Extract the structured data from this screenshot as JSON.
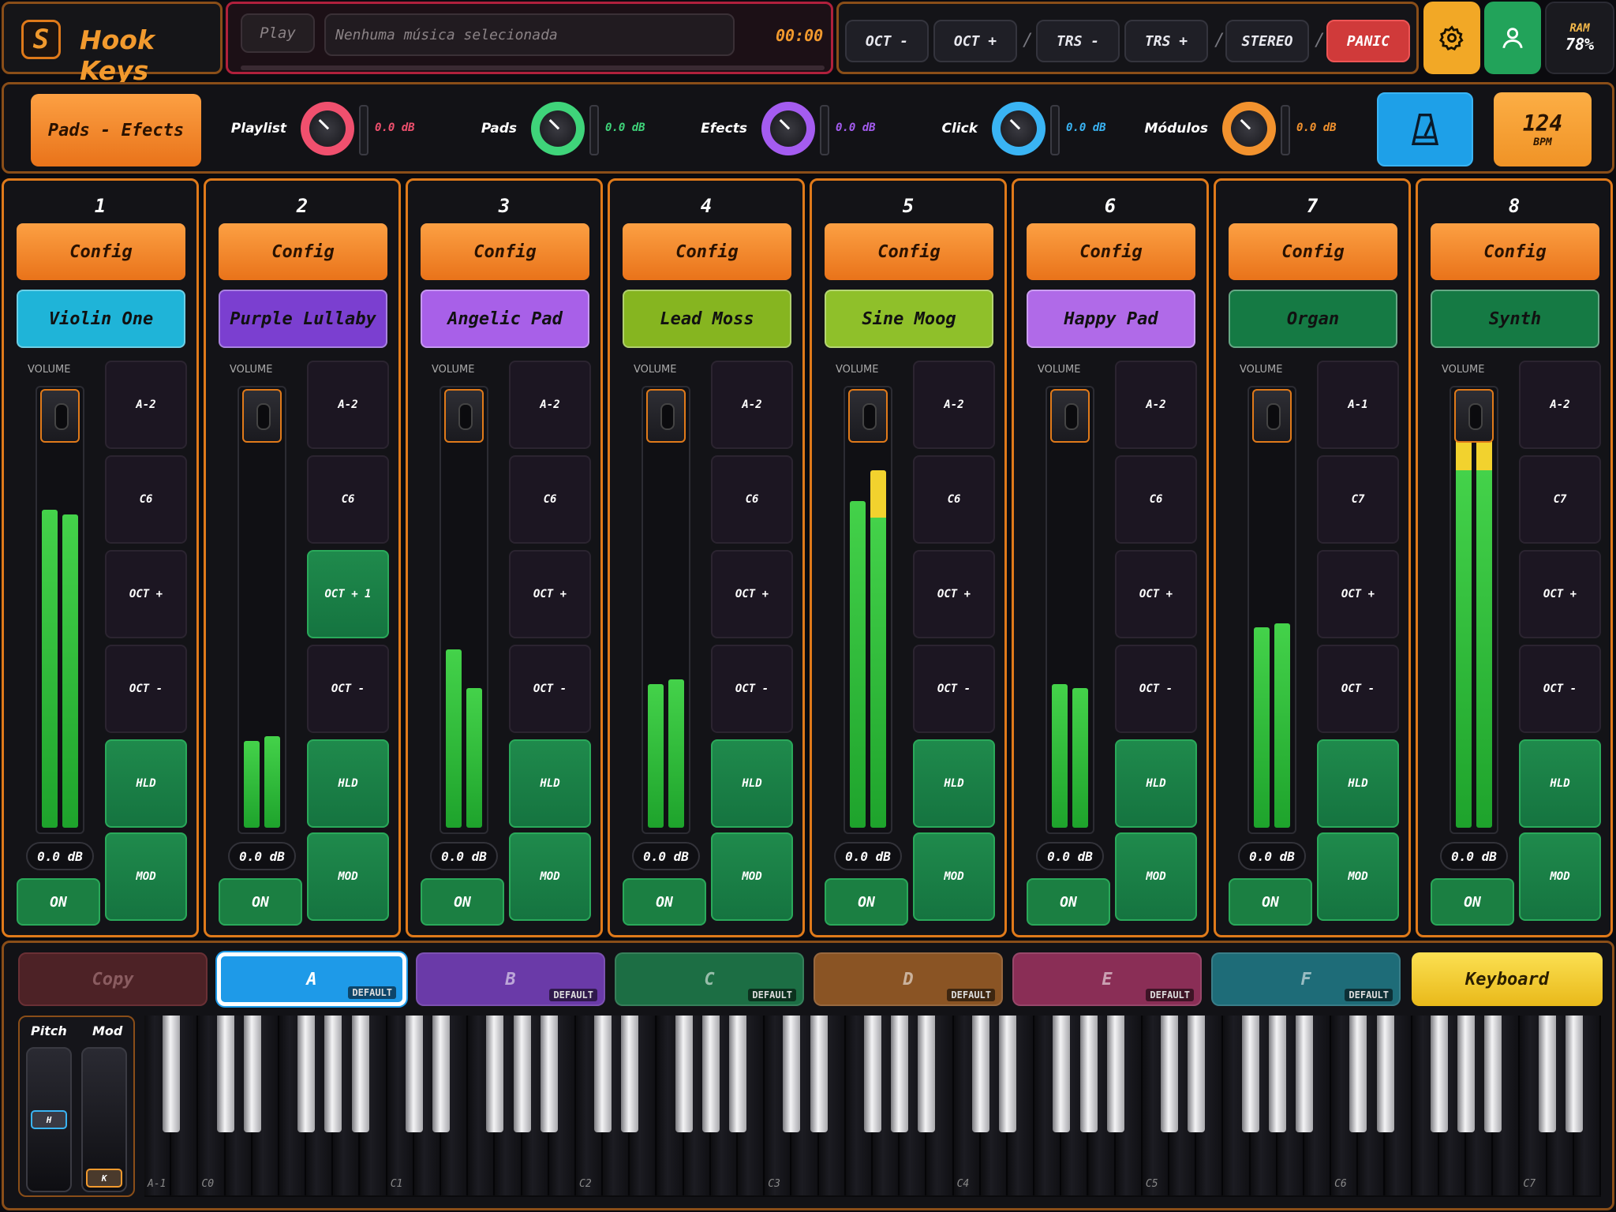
{
  "app": {
    "name": "Hook Keys",
    "logo_letter": "S"
  },
  "player": {
    "play_label": "Play",
    "track_placeholder": "Nenhuma música selecionada",
    "time": "00:00"
  },
  "transport": {
    "oct_minus": "OCT -",
    "oct_plus": "OCT +",
    "trs_minus": "TRS -",
    "trs_plus": "TRS +",
    "stereo": "STEREO",
    "panic": "PANIC",
    "separator": "/"
  },
  "system": {
    "ram_label": "RAM",
    "ram_value": "78%"
  },
  "bus": {
    "mode_label": "Pads - Efects",
    "items": [
      {
        "label": "Playlist",
        "db": "0.0 dB",
        "color": "#f0506e"
      },
      {
        "label": "Pads",
        "db": "0.0 dB",
        "color": "#3fd47a"
      },
      {
        "label": "Efects",
        "db": "0.0 dB",
        "color": "#a45cf0"
      },
      {
        "label": "Click",
        "db": "0.0 dB",
        "color": "#3ab4f4"
      },
      {
        "label": "Módulos",
        "db": "0.0 dB",
        "color": "#f2922e"
      }
    ],
    "bpm_value": "124",
    "bpm_label": "BPM"
  },
  "channel_common": {
    "config_label": "Config",
    "volume_label": "VOLUME",
    "db": "0.0 dB",
    "on_label": "ON",
    "hld_label": "HLD",
    "mod_label": "MOD",
    "oct_plus": "OCT +",
    "oct_minus": "OCT -"
  },
  "channels": [
    {
      "num": "1",
      "instrument": "Violin One",
      "color": "#1fb4d8",
      "low": "A-2",
      "high": "C6",
      "oct_label": "OCT +",
      "oct_active": false,
      "meter": [
        0.73,
        0.72
      ],
      "peak": [
        false,
        false
      ]
    },
    {
      "num": "2",
      "instrument": "Purple Lullaby",
      "color": "#7b3fd0",
      "low": "A-2",
      "high": "C6",
      "oct_label": "OCT + 1",
      "oct_active": true,
      "meter": [
        0.2,
        0.21
      ],
      "peak": [
        false,
        false
      ]
    },
    {
      "num": "3",
      "instrument": "Angelic Pad",
      "color": "#a860e8",
      "low": "A-2",
      "high": "C6",
      "oct_label": "OCT +",
      "oct_active": false,
      "meter": [
        0.41,
        0.32
      ],
      "peak": [
        false,
        false
      ]
    },
    {
      "num": "4",
      "instrument": "Lead Moss",
      "color": "#86b520",
      "low": "A-2",
      "high": "C6",
      "oct_label": "OCT +",
      "oct_active": false,
      "meter": [
        0.33,
        0.34
      ],
      "peak": [
        false,
        false
      ]
    },
    {
      "num": "5",
      "instrument": "Sine Moog",
      "color": "#8fc02a",
      "low": "A-2",
      "high": "C6",
      "oct_label": "OCT +",
      "oct_active": false,
      "meter": [
        0.75,
        0.82
      ],
      "peak": [
        false,
        true
      ]
    },
    {
      "num": "6",
      "instrument": "Happy Pad",
      "color": "#b06ae8",
      "low": "A-2",
      "high": "C6",
      "oct_label": "OCT +",
      "oct_active": false,
      "meter": [
        0.33,
        0.32
      ],
      "peak": [
        false,
        false
      ]
    },
    {
      "num": "7",
      "instrument": "Organ",
      "color": "#157a44",
      "low": "A-1",
      "high": "C7",
      "oct_label": "OCT +",
      "oct_active": false,
      "meter": [
        0.46,
        0.47
      ],
      "peak": [
        false,
        false
      ]
    },
    {
      "num": "8",
      "instrument": "Synth",
      "color": "#157a44",
      "low": "A-2",
      "high": "C7",
      "oct_label": "OCT +",
      "oct_active": false,
      "meter": [
        0.93,
        0.93
      ],
      "peak": [
        true,
        true
      ]
    }
  ],
  "presets": {
    "copy_label": "Copy",
    "default_badge": "DEFAULT",
    "items": [
      {
        "label": "A",
        "color": "#1e9ae8",
        "active": true
      },
      {
        "label": "B",
        "color": "#6a3aa8",
        "active": false
      },
      {
        "label": "C",
        "color": "#1c6e44",
        "active": false
      },
      {
        "label": "D",
        "color": "#8a5424",
        "active": false
      },
      {
        "label": "E",
        "color": "#8a2e56",
        "active": false
      },
      {
        "label": "F",
        "color": "#1e6c78",
        "active": false
      }
    ],
    "keyboard_label": "Keyboard"
  },
  "wheels": {
    "pitch_label": "Pitch",
    "mod_label": "Mod",
    "pitch_handle": "H",
    "mod_handle": "K",
    "pitch_value": 0.5,
    "mod_value": 0.0
  },
  "octave_labels": [
    "A-1",
    "C0",
    "C1",
    "C2",
    "C3",
    "C4",
    "C5",
    "C6",
    "C7"
  ]
}
